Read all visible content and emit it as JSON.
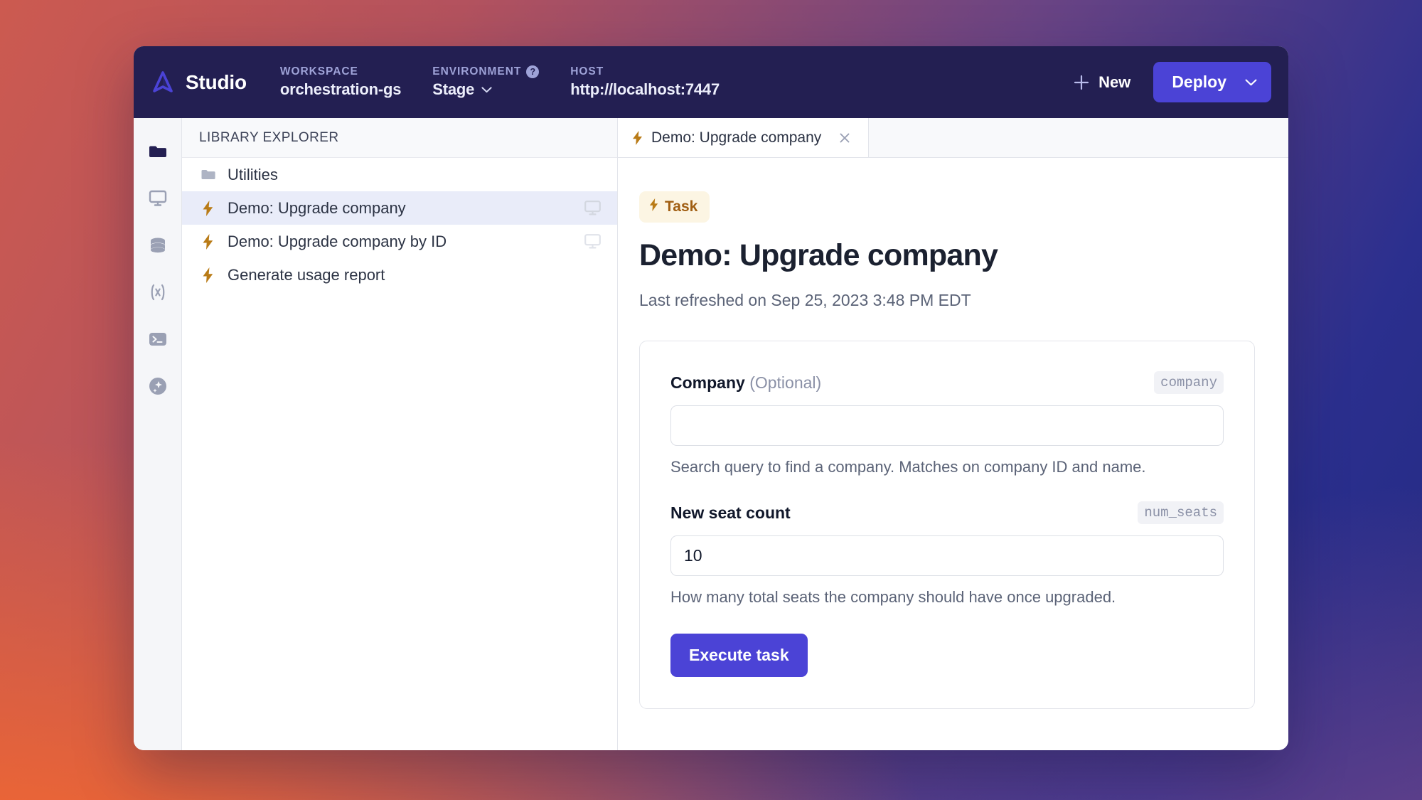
{
  "topbar": {
    "brand_name": "Studio",
    "logo_icon": "airplane-logo-icon",
    "workspace_label": "WORKSPACE",
    "workspace_value": "orchestration-gs",
    "environment_label": "ENVIRONMENT",
    "environment_help_glyph": "?",
    "environment_value": "Stage",
    "host_label": "HOST",
    "host_value": "http://localhost:7447",
    "new_label": "New",
    "deploy_label": "Deploy",
    "accent_color": "#4b43d6",
    "bar_color": "#231f52"
  },
  "rail": {
    "items": [
      {
        "icon": "folder-icon",
        "active": true
      },
      {
        "icon": "monitor-icon",
        "active": false
      },
      {
        "icon": "database-icon",
        "active": false
      },
      {
        "icon": "variable-icon",
        "active": false
      },
      {
        "icon": "terminal-icon",
        "active": false
      },
      {
        "icon": "sparkle-icon",
        "active": false
      }
    ]
  },
  "explorer": {
    "title": "LIBRARY EXPLORER",
    "items": [
      {
        "label": "Utilities",
        "icon": "folder-icon",
        "selected": false,
        "trailing": null
      },
      {
        "label": "Demo: Upgrade company",
        "icon": "lightning-icon",
        "selected": true,
        "trailing": "monitor-icon"
      },
      {
        "label": "Demo: Upgrade company by ID",
        "icon": "lightning-icon",
        "selected": false,
        "trailing": "monitor-icon"
      },
      {
        "label": "Generate usage report",
        "icon": "lightning-icon",
        "selected": false,
        "trailing": null
      }
    ]
  },
  "tabs": [
    {
      "label": "Demo: Upgrade company",
      "icon": "lightning-icon",
      "active": true,
      "close_glyph": "×"
    }
  ],
  "main": {
    "badge_label": "Task",
    "badge_icon": "lightning-icon",
    "title": "Demo: Upgrade company",
    "last_refreshed": "Last refreshed on Sep 25, 2023 3:48 PM EDT",
    "fields": [
      {
        "label": "Company",
        "optional_suffix": "(Optional)",
        "key": "company",
        "value": "",
        "placeholder": "",
        "help": "Search query to find a company. Matches on company ID and name."
      },
      {
        "label": "New seat count",
        "optional_suffix": "",
        "key": "num_seats",
        "value": "10",
        "placeholder": "",
        "help": "How many total seats the company should have once upgraded."
      }
    ],
    "execute_label": "Execute task"
  }
}
